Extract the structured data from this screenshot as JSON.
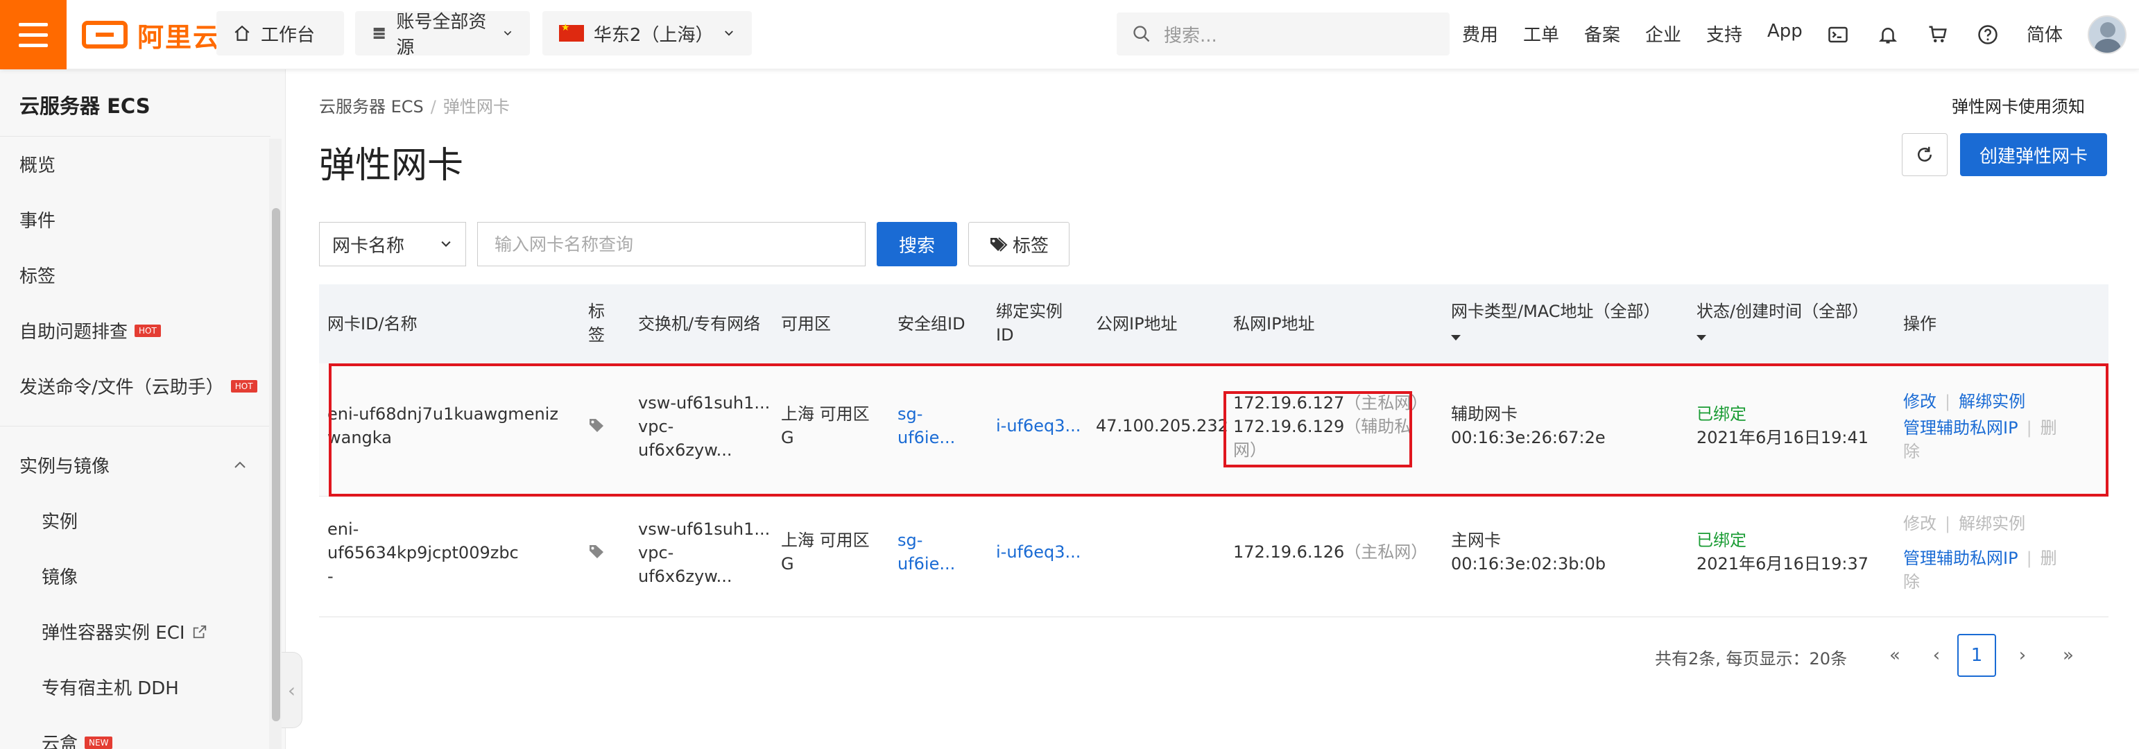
{
  "topbar": {
    "brand": "阿里云",
    "workbench": "工作台",
    "resources": "账号全部资源",
    "region": "华东2（上海）",
    "search_placeholder": "搜索...",
    "links": [
      "费用",
      "工单",
      "备案",
      "企业",
      "支持",
      "App"
    ],
    "lang": "简体",
    "icons": [
      "terminal-icon",
      "bell-icon",
      "cart-icon",
      "help-icon"
    ]
  },
  "sidebar": {
    "title": "云服务器 ECS",
    "items": [
      {
        "label": "概览"
      },
      {
        "label": "事件"
      },
      {
        "label": "标签"
      },
      {
        "label": "自助问题排查",
        "badge": "HOT"
      },
      {
        "label": "发送命令/文件（云助手）",
        "badge": "HOT"
      }
    ],
    "group": {
      "label": "实例与镜像",
      "children": [
        {
          "label": "实例"
        },
        {
          "label": "镜像"
        },
        {
          "label": "弹性容器实例 ECI"
        },
        {
          "label": "专有宿主机 DDH"
        },
        {
          "label": "云盒",
          "badge": "NEW"
        }
      ]
    }
  },
  "page": {
    "breadcrumb_root": "云服务器 ECS",
    "breadcrumb_current": "弹性网卡",
    "title": "弹性网卡",
    "help_link": "弹性网卡使用须知",
    "create_button": "创建弹性网卡"
  },
  "filter": {
    "field": "网卡名称",
    "placeholder": "输入网卡名称查询",
    "search_button": "搜索",
    "tag_button": "标签"
  },
  "table": {
    "columns": {
      "id": "网卡ID/名称",
      "tag": "标签",
      "vswitch": "交换机/专有网络",
      "zone": "可用区",
      "sg": "安全组ID",
      "instance": "绑定实例ID",
      "public_ip": "公网IP地址",
      "private_ip": "私网IP地址",
      "type": "网卡类型/MAC地址（全部）",
      "status": "状态/创建时间（全部）",
      "actions": "操作"
    },
    "rows": [
      {
        "id": "eni-uf68dnj7u1kuawgmeniz",
        "name": "wangka",
        "vswitch": "vsw-uf61suh1...",
        "vpc": "vpc-",
        "vpc2": "uf6x6zyw...",
        "zone": "上海 可用区",
        "zone2": "G",
        "sg": "sg-",
        "sg2": "uf6ie...",
        "instance": "i-uf6eq3...",
        "public_ip": "47.100.205.232",
        "ip1": "172.19.6.127",
        "ip1_note": "（主私网）",
        "ip2": "172.19.6.129",
        "ip2_note": "（辅助私",
        "ip2_note2": "网）",
        "type": "辅助网卡",
        "mac": "00:16:3e:26:67:2e",
        "status": "已绑定",
        "created": "2021年6月16日19:41",
        "act_modify": "修改",
        "act_unbind": "解绑实例",
        "act_manage": "管理辅助私网IP",
        "act_delete": "删",
        "act_delete2": "除"
      },
      {
        "id": "eni-",
        "id2": "uf65634kp9jcpt009zbc",
        "name": "-",
        "vswitch": "vsw-uf61suh1...",
        "vpc": "vpc-",
        "vpc2": "uf6x6zyw...",
        "zone": "上海 可用区",
        "zone2": "G",
        "sg": "sg-",
        "sg2": "uf6ie...",
        "instance": "i-uf6eq3...",
        "ip1": "172.19.6.126",
        "ip1_note": "（主私网）",
        "type": "主网卡",
        "mac": "00:16:3e:02:3b:0b",
        "status": "已绑定",
        "created": "2021年6月16日19:37",
        "act_modify": "修改",
        "act_unbind": "解绑实例",
        "act_manage": "管理辅助私网IP",
        "act_delete": "删",
        "act_delete2": "除"
      }
    ]
  },
  "pagination": {
    "info": "共有2条, 每页显示：20条",
    "current": "1"
  },
  "colors": {
    "brand": "#ff6a00",
    "primary": "#1a6bd4",
    "success": "#1a9c34",
    "highlight": "#e0161e"
  }
}
